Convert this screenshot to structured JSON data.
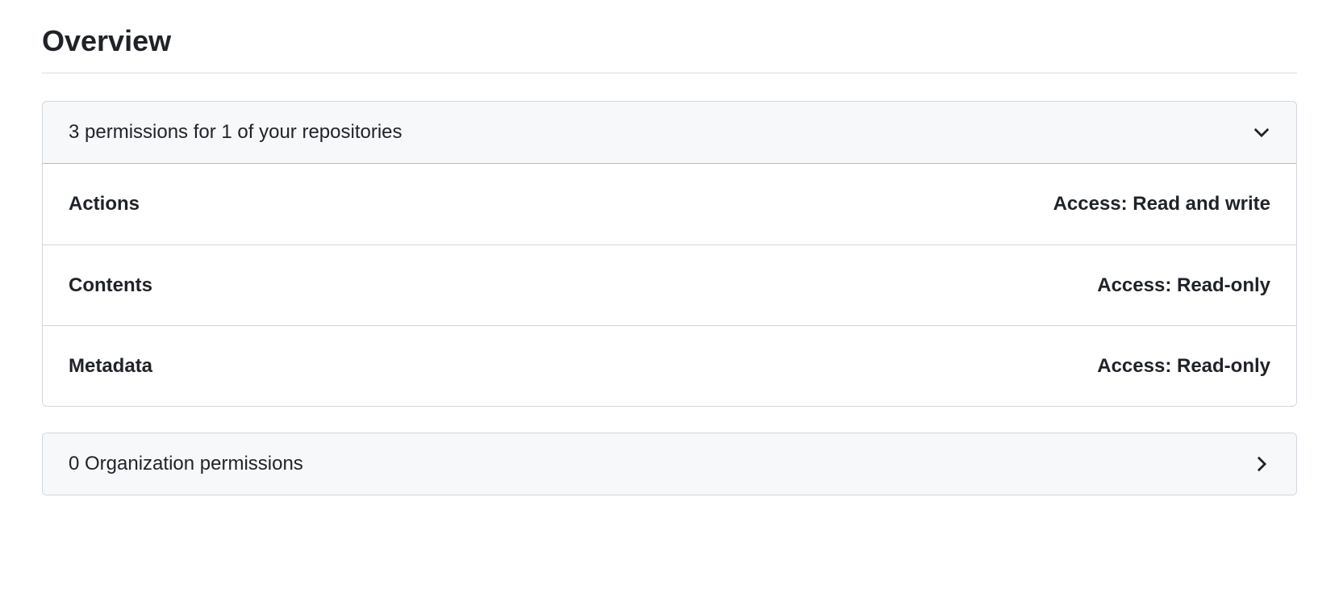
{
  "title": "Overview",
  "repoPermissions": {
    "header": "3 permissions for 1 of your repositories",
    "items": [
      {
        "name": "Actions",
        "access": "Access: Read and write"
      },
      {
        "name": "Contents",
        "access": "Access: Read-only"
      },
      {
        "name": "Metadata",
        "access": "Access: Read-only"
      }
    ]
  },
  "orgPermissions": {
    "header": "0 Organization permissions"
  }
}
